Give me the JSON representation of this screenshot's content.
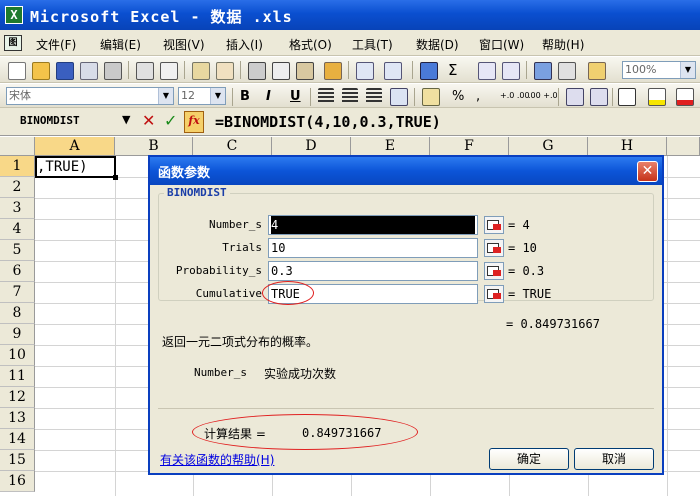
{
  "window": {
    "app_icon": "X",
    "title": "Microsoft Excel - 数据 .xls"
  },
  "menu": {
    "doc_icon": "图",
    "items": [
      "文件(F)",
      "编辑(E)",
      "视图(V)",
      "插入(I)",
      "格式(O)",
      "工具(T)",
      "数据(D)",
      "窗口(W)",
      "帮助(H)"
    ]
  },
  "toolbar": {
    "zoom": "100%",
    "sigma": "Σ"
  },
  "format_bar": {
    "font": "宋体",
    "size": "12",
    "bold": "B",
    "italic": "I",
    "underline": "U",
    "percent": "%",
    "comma": ",",
    "inc_decimal": "+.0 .00",
    "dec_decimal": ".00 +.0"
  },
  "formula_bar": {
    "name_box": "BINOMDIST",
    "cancel": "✕",
    "enter": "✓",
    "fx": "fx",
    "formula": "=BINOMDIST(4,10,0.3,TRUE)"
  },
  "sheet": {
    "columns": [
      "A",
      "B",
      "C",
      "D",
      "E",
      "F",
      "G",
      "H"
    ],
    "rows": [
      "1",
      "2",
      "3",
      "4",
      "5",
      "6",
      "7",
      "8",
      "9",
      "10",
      "11",
      "12",
      "13",
      "14",
      "15",
      "16"
    ],
    "cell_a1": ",TRUE)"
  },
  "dialog": {
    "title": "函数参数",
    "close": "✕",
    "function_name": "BINOMDIST",
    "args": [
      {
        "label": "Number_s",
        "value": "4",
        "result": "= 4"
      },
      {
        "label": "Trials",
        "value": "10",
        "result": "= 10"
      },
      {
        "label": "Probability_s",
        "value": "0.3",
        "result": "= 0.3"
      },
      {
        "label": "Cumulative",
        "value": "TRUE",
        "result": "= TRUE"
      }
    ],
    "formula_result": "= 0.849731667",
    "description": "返回一元二项式分布的概率。",
    "arg_help_name": "Number_s",
    "arg_help_text": "实验成功次数",
    "calc_result_label": "计算结果 =",
    "calc_result_value": "0.849731667",
    "help_link": "有关该函数的帮助(H)",
    "ok_label": "确定",
    "cancel_label": "取消"
  },
  "colors": {
    "title_blue": "#0a4fd0",
    "face": "#ece9d8",
    "highlight_red": "#e02020"
  }
}
